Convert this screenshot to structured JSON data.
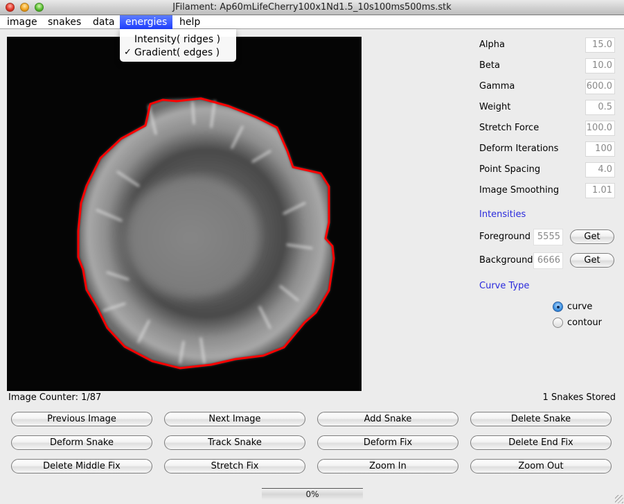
{
  "window": {
    "title": "JFilament: Ap60mLifeCherry100x1Nd1.5_10s100ms500ms.stk"
  },
  "menubar": {
    "items": [
      {
        "label": "image",
        "active": false
      },
      {
        "label": "snakes",
        "active": false
      },
      {
        "label": "data",
        "active": false
      },
      {
        "label": "energies",
        "active": true
      },
      {
        "label": "help",
        "active": false
      }
    ]
  },
  "energies_menu": {
    "items": [
      {
        "label": "Intensity( ridges )",
        "checked": false,
        "check_glyph": ""
      },
      {
        "label": "Gradient( edges )",
        "checked": true,
        "check_glyph": "✓"
      }
    ]
  },
  "parameters": [
    {
      "label": "Alpha",
      "value": "15.0"
    },
    {
      "label": "Beta",
      "value": "10.0"
    },
    {
      "label": "Gamma",
      "value": "600.0"
    },
    {
      "label": "Weight",
      "value": "0.5"
    },
    {
      "label": "Stretch Force",
      "value": "100.0"
    },
    {
      "label": "Deform Iterations",
      "value": "100"
    },
    {
      "label": "Point Spacing",
      "value": "4.0"
    },
    {
      "label": "Image Smoothing",
      "value": "1.01"
    }
  ],
  "intensities": {
    "title": "Intensities",
    "foreground": {
      "label": "Foreground",
      "value": "5555",
      "button": "Get"
    },
    "background": {
      "label": "Background",
      "value": "6666",
      "button": "Get"
    }
  },
  "curve_type": {
    "title": "Curve Type",
    "options": [
      {
        "label": "curve",
        "selected": true
      },
      {
        "label": "contour",
        "selected": false
      }
    ]
  },
  "status": {
    "image_counter": "Image Counter: 1/87",
    "snakes_stored": "1 Snakes Stored"
  },
  "buttons": [
    [
      "Previous Image",
      "Next Image",
      "Add Snake",
      "Delete Snake"
    ],
    [
      "Deform Snake",
      "Track Snake",
      "Deform Fix",
      "Delete End Fix"
    ],
    [
      "Delete Middle Fix",
      "Stretch Fix",
      "Zoom In",
      "Zoom Out"
    ]
  ],
  "progress": {
    "value": 0,
    "label": "0%"
  },
  "image": {
    "description": "fluorescence microscopy image of a round cell",
    "snake_color": "#ff0000",
    "snake_count": 1
  },
  "colors": {
    "menu_highlight": "#2a4bff",
    "section_title": "#2a2adc",
    "snake": "#ff0000"
  }
}
